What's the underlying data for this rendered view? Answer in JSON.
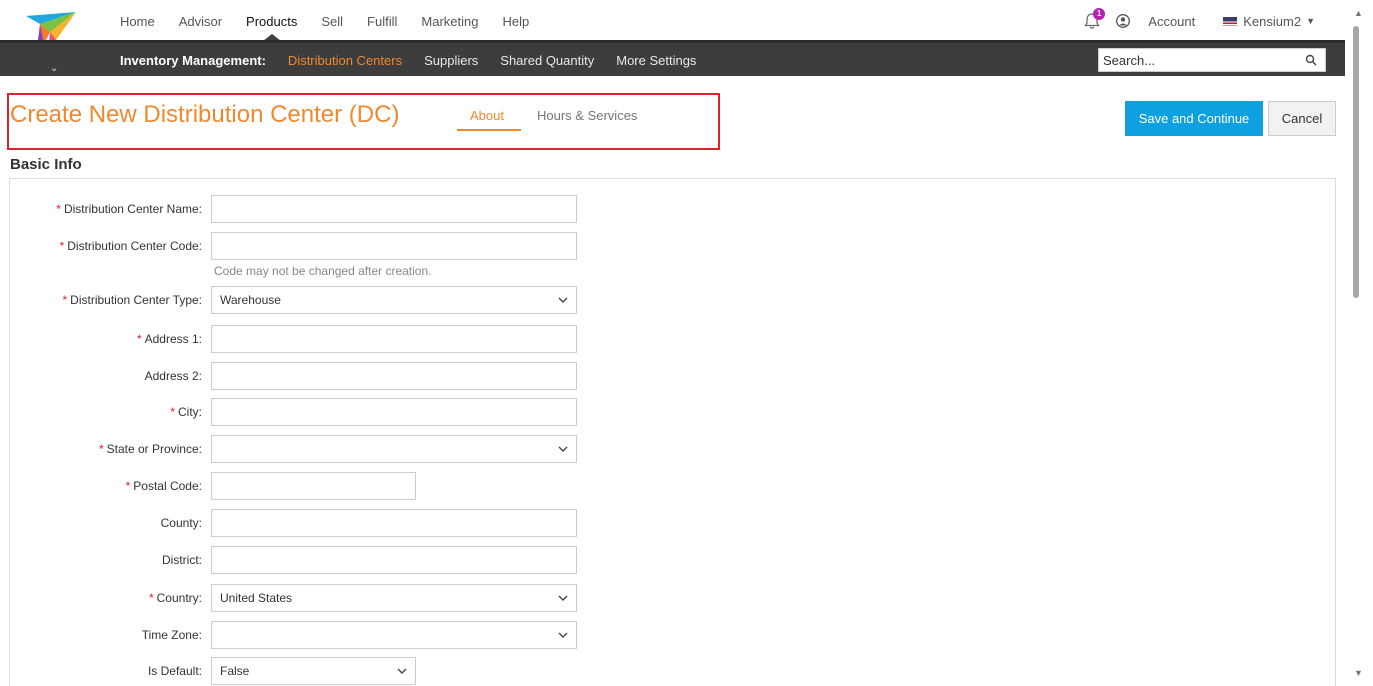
{
  "topnav": {
    "items": [
      "Home",
      "Advisor",
      "Products",
      "Sell",
      "Fulfill",
      "Marketing",
      "Help"
    ],
    "active_index": 2,
    "notification_count": "1",
    "account_label": "Account",
    "tenant_label": "Kensium2"
  },
  "subnav": {
    "section_label": "Inventory Management:",
    "items": [
      "Distribution Centers",
      "Suppliers",
      "Shared Quantity",
      "More Settings"
    ],
    "active_index": 0,
    "search_placeholder": "Search..."
  },
  "page": {
    "title": "Create New Distribution Center (DC)",
    "tabs": [
      "About",
      "Hours & Services"
    ],
    "active_tab": "About",
    "save_label": "Save and Continue",
    "cancel_label": "Cancel",
    "section_title": "Basic Info"
  },
  "form": {
    "name_label": "Distribution Center Name:",
    "name_value": "",
    "code_label": "Distribution Center Code:",
    "code_value": "",
    "code_hint": "Code may not be changed after creation.",
    "type_label": "Distribution Center Type:",
    "type_value": "Warehouse",
    "address1_label": "Address 1:",
    "address1_value": "",
    "address2_label": "Address 2:",
    "address2_value": "",
    "city_label": "City:",
    "city_value": "",
    "state_label": "State or Province:",
    "state_value": "",
    "postal_label": "Postal Code:",
    "postal_value": "",
    "county_label": "County:",
    "county_value": "",
    "district_label": "District:",
    "district_value": "",
    "country_label": "Country:",
    "country_value": "United States",
    "timezone_label": "Time Zone:",
    "timezone_value": "",
    "default_label": "Is Default:",
    "default_value": "False",
    "required_marker": "*"
  },
  "colors": {
    "accent_orange": "#f0892e",
    "primary_blue": "#0ea0e0",
    "dark_bar": "#3d3d3d",
    "highlight_red": "#e0202a",
    "badge_purple": "#b21fb2"
  }
}
